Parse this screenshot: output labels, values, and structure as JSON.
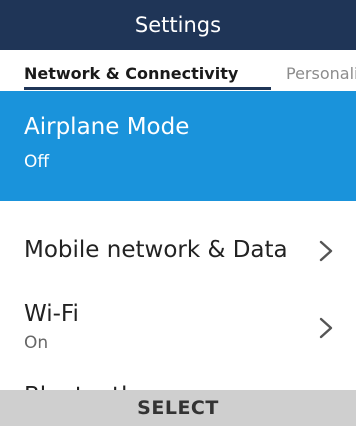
{
  "header": {
    "title": "Settings"
  },
  "tabs": [
    {
      "label": "Network & Connectivity",
      "active": true
    },
    {
      "label": "Personalization",
      "active": false
    }
  ],
  "list": {
    "items": [
      {
        "label": "Airplane Mode",
        "value": "Off",
        "selected": true
      },
      {
        "label": "Mobile network & Data",
        "value": "",
        "selected": false,
        "icon": "chevron-right-icon"
      },
      {
        "label": "Wi-Fi",
        "value": "On",
        "selected": false,
        "icon": "chevron-right-icon"
      },
      {
        "label": "Bluetooth",
        "value": "",
        "selected": false
      }
    ]
  },
  "softkey": {
    "center_label": "SELECT"
  },
  "colors": {
    "header_bg": "#1f3557",
    "selected_bg": "#1a93db",
    "softkey_bg": "#cfcfcf"
  }
}
